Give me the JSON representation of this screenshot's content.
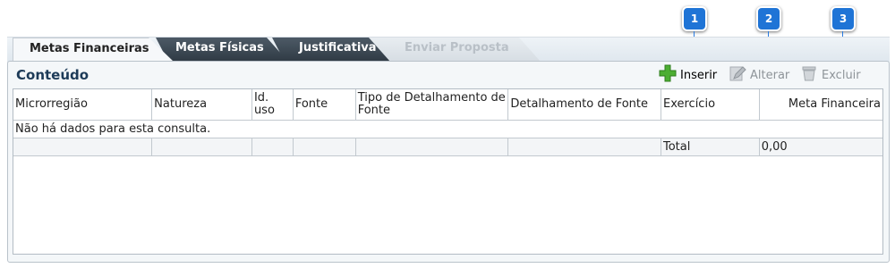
{
  "tabs": [
    {
      "label": "Metas Financeiras",
      "state": "active"
    },
    {
      "label": "Metas Físicas",
      "state": "normal"
    },
    {
      "label": "Justificativa",
      "state": "normal"
    },
    {
      "label": "Enviar Proposta",
      "state": "disabled"
    }
  ],
  "panel": {
    "title": "Conteúdo"
  },
  "toolbar": {
    "insert_label": "Inserir",
    "edit_label": "Alterar",
    "delete_label": "Excluir"
  },
  "callouts": [
    "1",
    "2",
    "3"
  ],
  "grid": {
    "columns": [
      "Microrregião",
      "Natureza",
      "Id. uso",
      "Fonte",
      "Tipo de Detalhamento de Fonte",
      "Detalhamento de Fonte",
      "Exercício",
      "Meta Financeira"
    ],
    "empty_message": "Não há dados para esta consulta.",
    "total_label": "Total",
    "total_value": "0,00"
  },
  "colors": {
    "accent": "#1f74d6",
    "tab_dark": "#3a4651",
    "insert_icon": "#4cae32"
  },
  "icons": {
    "insert": "plus-icon",
    "edit": "pencil-icon",
    "delete": "trash-icon"
  }
}
